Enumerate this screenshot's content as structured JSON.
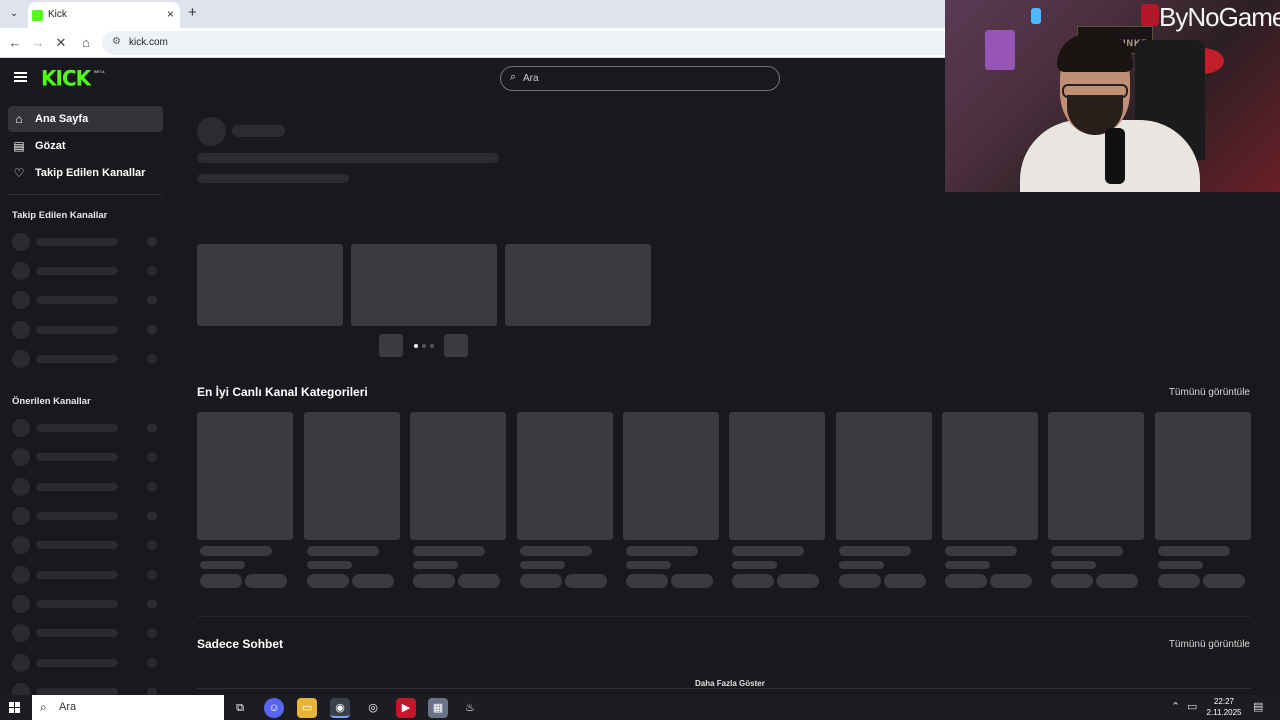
{
  "browser": {
    "tab_title": "Kick",
    "tab_close": "×",
    "new_tab": "+",
    "url": "kick.com",
    "nav": {
      "back": "←",
      "forward": "→",
      "reload": "✕",
      "home": "⌂",
      "site_info": "⚙"
    }
  },
  "kick": {
    "logo": "KICK",
    "logo_badge": "BETA",
    "search_placeholder": "Ara",
    "sidebar": {
      "items": [
        {
          "label": "Ana Sayfa",
          "icon": "home-icon",
          "active": true
        },
        {
          "label": "Gözat",
          "icon": "browse-icon",
          "active": false
        },
        {
          "label": "Takip Edilen Kanallar",
          "icon": "heart-icon",
          "active": false
        }
      ],
      "followed_header": "Takip Edilen Kanallar",
      "recommended_header": "Önerilen Kanallar"
    },
    "sections": {
      "top_categories_title": "En İyi Canlı Kanal Kategorileri",
      "top_categories_link": "Tümünü görüntüle",
      "chat_only_title": "Sadece Sohbet",
      "chat_only_link": "Tümünü görüntüle",
      "show_more": "Daha Fazla Göster"
    }
  },
  "overlay": {
    "brand": "ByNoGame",
    "sign_text": "KARAGUNK7"
  },
  "taskbar": {
    "search_placeholder": "Ara",
    "time": "22:27",
    "date": "2.11.2025"
  },
  "colors": {
    "kick_green": "#53fc18",
    "page_bg": "#18191c",
    "skeleton": "#2b2c30",
    "card": "#3a3b40"
  }
}
